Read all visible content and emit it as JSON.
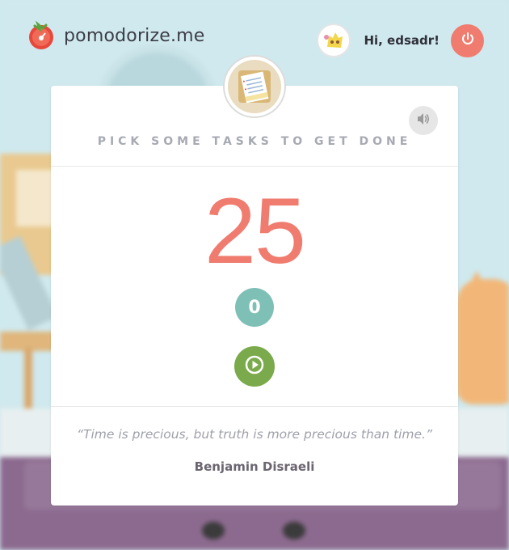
{
  "header": {
    "logo_text": "pomodorize.me",
    "greeting": "Hi, edsadr!"
  },
  "card": {
    "prompt": "PICK SOME TASKS TO GET DONE",
    "timer_minutes": "25",
    "pomodoro_count": "0",
    "quote": "“Time is precious, but truth is more precious than time.”",
    "quote_author": "Benjamin Disraeli"
  },
  "icons": {
    "logo": "tomato-logo-icon",
    "avatar": "user-avatar",
    "power": "power-icon",
    "badge": "task-list-icon",
    "sound": "speaker-icon",
    "play": "play-icon"
  },
  "colors": {
    "accent_red": "#f07c6f",
    "teal": "#7ebfb6",
    "green": "#7aaa4b",
    "prompt_gray": "#a7aab3"
  }
}
